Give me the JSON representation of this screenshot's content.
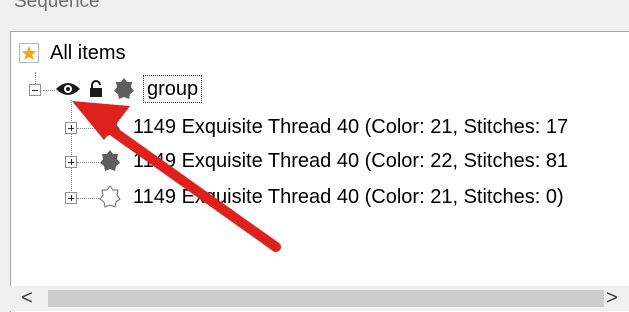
{
  "panel": {
    "title": "Sequence"
  },
  "tree": {
    "root_label": "All items",
    "group_label": "group",
    "items": [
      {
        "label": "1149 Exquisite Thread 40 (Color: 21, Stitches: 17"
      },
      {
        "label": "1149 Exquisite Thread 40 (Color: 22, Stitches: 81"
      },
      {
        "label": "1149 Exquisite Thread 40 (Color: 21, Stitches: 0)"
      }
    ]
  },
  "scrollbar": {
    "left_arrow": "<",
    "right_arrow": ">"
  },
  "colors": {
    "annotation_arrow": "#e0201b",
    "star": "#f4a51c"
  },
  "icons": [
    "star-icon",
    "eye-icon",
    "lock-icon",
    "shape-icon",
    "outline-shape-icon",
    "arrow-annotation"
  ]
}
